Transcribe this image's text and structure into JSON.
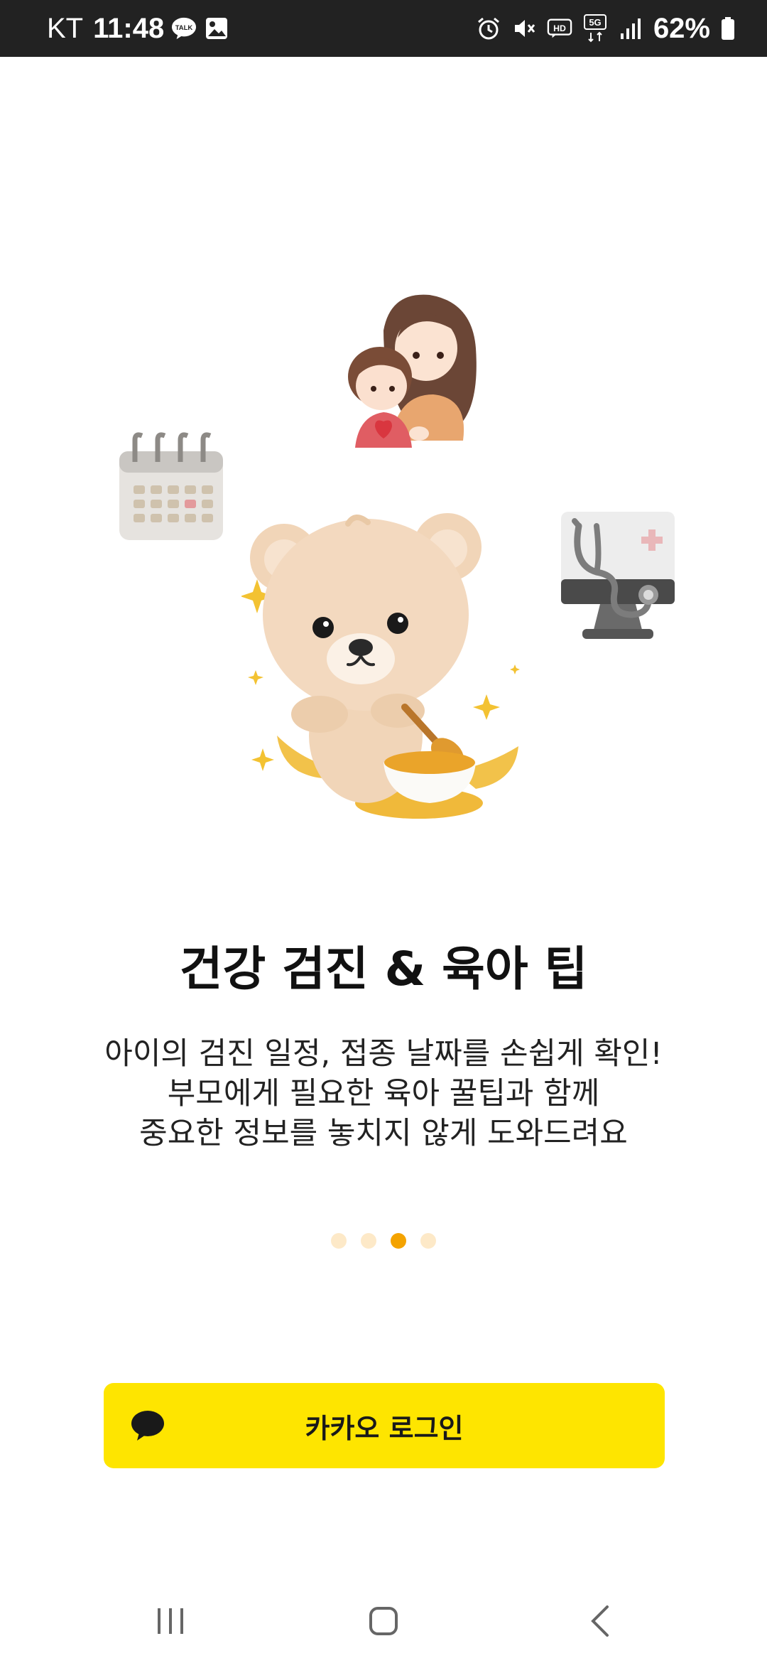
{
  "status_bar": {
    "carrier": "KT",
    "time": "11:48",
    "talk_badge": "TALK",
    "network_badge": "5G",
    "hd_badge": "HD",
    "battery": "62%"
  },
  "onboarding": {
    "title": "건강 검진 & 육아 팁",
    "description_lines": [
      "아이의 검진 일정, 접종 날짜를 손쉽게 확인!",
      "부모에게 필요한 육아 꿀팁과 함께",
      "중요한 정보를 놓치지 않게 도와드려요"
    ],
    "page_count": 4,
    "current_page": 3
  },
  "login": {
    "kakao_label": "카카오 로그인",
    "button_color": "#FEE500"
  },
  "colors": {
    "accent": "#F4A300",
    "dot_inactive": "#FDE9C8",
    "status_bar_bg": "#222222"
  },
  "icons": {
    "talk": "kakaotalk-bubble-icon",
    "gallery": "image-icon",
    "alarm": "alarm-clock-icon",
    "mute": "vibrate-mute-icon",
    "signal": "signal-bars-icon",
    "battery": "battery-icon",
    "recents": "recent-apps-icon",
    "home": "home-icon",
    "back": "back-chevron-icon"
  }
}
